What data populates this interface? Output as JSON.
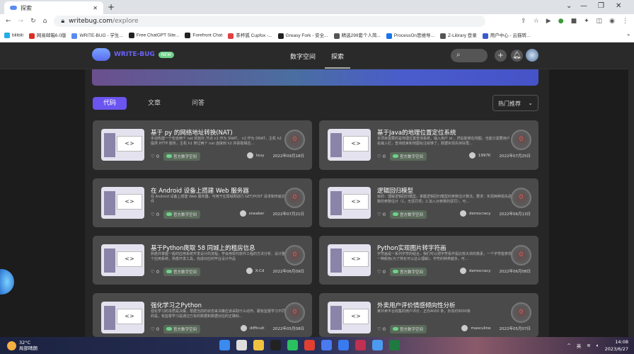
{
  "browser": {
    "tab_title": "探索",
    "url_host": "writebug.com",
    "url_path": "/explore",
    "bookmarks": [
      "bilibili",
      "网易邮箱6.0版",
      "WRITE-BUG - 学生...",
      "Free ChatGPT Site...",
      "Forefront Chat",
      "茶杯狐 Cupfox -...",
      "Greasy Fork - 安全...",
      "精选299套个人简...",
      "ProcessOn思维导...",
      "Z-Library 登录",
      "用户中心 - 云猫转..."
    ],
    "bookmark_colors": [
      "#23ade5",
      "#d93025",
      "#5a8af0",
      "#222222",
      "#222222",
      "#e04040",
      "#222222",
      "#555555",
      "#1a73e8",
      "#555555",
      "#3a5ad0"
    ]
  },
  "site": {
    "logo": "WRITE-BUG",
    "new_badge": "NEW",
    "nav": [
      "数字空间",
      "探索"
    ],
    "filter_tabs": [
      "代码",
      "文章",
      "问答"
    ],
    "sort": "热门推荐",
    "accent": "#6b55f0"
  },
  "cards": [
    {
      "title": "基于 py 的网络地址转换(NAT)",
      "desc": "手动构建一个包含两个 nat 的拓扑,节点 n1 作为 SNAT， n2 作为 DNAT，主机 h2 提供 HTTP 服务，主机 h1 穿过两个 nat 连接到 h2 并获取相应...",
      "likes": "0",
      "badge": "官方数字空间",
      "author": "louy",
      "date": "2022年09月18日",
      "score": "0"
    },
    {
      "title": "基于Java的地理位置定位系统",
      "desc": "本项目需要的是地理位置查询系统，输入用户 id ，然后能够在地图，也能只需要用户名输入栏，查询结束和地图标注就够了，数据实现先存好再...",
      "likes": "0",
      "badge": "官方数字空间",
      "author": "1997K",
      "date": "2022年07月25日",
      "score": "0"
    },
    {
      "title": "在 Android 设备上搭建 Web 服务器",
      "desc": "在 Android 设备上搭建 Web 服务器，可用于在局域网进行 GET/POST 请求和传输文件",
      "likes": "0",
      "badge": "官方数字空间",
      "author": "sneaker",
      "date": "2022年07月21日",
      "score": "0"
    },
    {
      "title": "逻辑回归模型",
      "desc": "目的：理解逻辑回归模型，掌握逻辑回归模型的参数估计算法。要求：实现两种损失函数的参数估计（1，无惩罚项；2.加入对参数的惩罚），可...",
      "likes": "0",
      "badge": "官方数字空间",
      "author": "democracy",
      "date": "2022年06月13日",
      "score": "0"
    },
    {
      "title": "基于Python爬取 58 同城上的租房信息",
      "desc": "熟悉并掌握一般的应用系统开发设计的流程，学会用现代软件工程的方法分析、设计整个应用系统，熟悉开发工具，完成对应的毕业设计作品",
      "likes": "0",
      "badge": "官方数字空间",
      "author": "X-Cd",
      "date": "2022年06月09日",
      "score": "0"
    },
    {
      "title": "Python实现图片转字符画",
      "desc": "字符画是一系列字符的组合，我们可以把字符看作是比较大块的像素，一个字符能表现一种颜色(为了简化可以这么理解)，字符的种类越多，可...",
      "likes": "0",
      "badge": "官方数字空间",
      "author": "democracy",
      "date": "2022年06月08日",
      "score": "0"
    },
    {
      "title": "强化学习之Python",
      "desc": "强化学习的本质是决策，根据当前的状态来决策应该采取什么动作。跟有监督学习不同的是，有监督学习是通过已有的数据和数据对应的正确标...",
      "likes": "0",
      "badge": "官方数字空间",
      "author": "difficult",
      "date": "2022年05月08日",
      "score": "0"
    },
    {
      "title": "外卖用户评价情感倾向性分析",
      "desc": "某外卖平台收集的用户评价，正向4000 条，负向约8000条",
      "likes": "0",
      "badge": "官方数字空间",
      "author": "masculine",
      "date": "2022年05月07日",
      "score": "0"
    }
  ],
  "taskbar": {
    "temp": "32°C",
    "weather": "局部晴朗",
    "ime": "英",
    "time": "14:08",
    "date": "2023/6/27",
    "app_colors": [
      "#3a8af0",
      "#dddddd",
      "#f0c040",
      "#222222",
      "#2ac060",
      "#e04030",
      "#4a7af0",
      "#3a7af0",
      "#c03050",
      "#4a9af0",
      "#1e7a40"
    ]
  }
}
